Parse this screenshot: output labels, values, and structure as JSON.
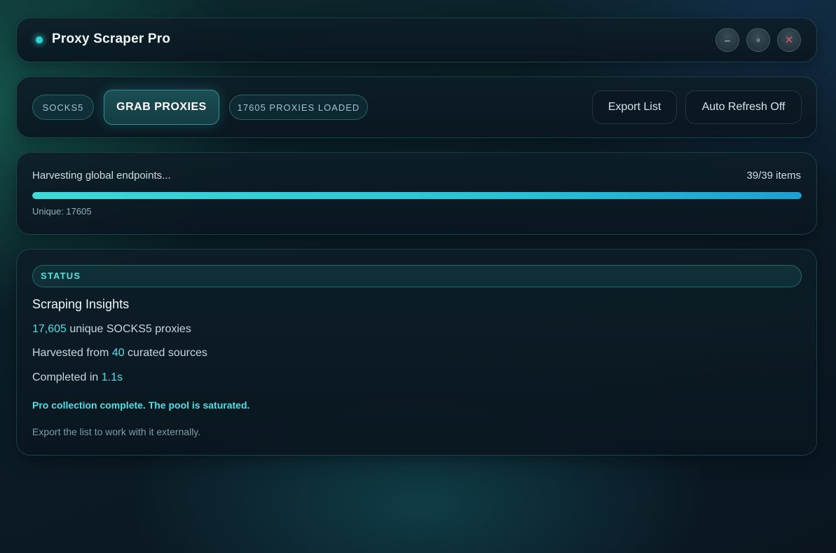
{
  "window": {
    "title": "Proxy Scraper Pro",
    "minimize_glyph": "–",
    "maximize_glyph": "▫",
    "close_glyph": "✕"
  },
  "toolbar": {
    "protocol": "SOCKS5",
    "grab_label": "GRAB PROXIES",
    "loaded_label": "17605 PROXIES LOADED",
    "export_label": "Export List",
    "auto_refresh_label": "Auto Refresh Off"
  },
  "progress": {
    "label": "Harvesting global endpoints...",
    "count": "39/39 items",
    "fraction": 1.0,
    "unique_label": "Unique: 17605"
  },
  "status": {
    "header": "STATUS",
    "title": "Scraping Insights",
    "proxies_value": "17,605",
    "proxies_suffix": " unique SOCKS5 proxies",
    "sources_prefix": "Harvested from ",
    "sources_value": "40",
    "sources_suffix": " curated sources",
    "time_prefix": "Completed in ",
    "time_value": "1.1s",
    "complete_message": "Pro collection complete. The pool is saturated.",
    "hint": "Export the list to work with it externally."
  },
  "colors": {
    "accent": "#4fe0e4",
    "progress_start": "#3fd9d6",
    "progress_end": "#1e9fd0",
    "close_icon": "#e05565"
  },
  "icons": {
    "status_dot": "status-dot-icon",
    "minimize": "minimize-icon",
    "maximize": "maximize-icon",
    "close": "close-icon"
  }
}
